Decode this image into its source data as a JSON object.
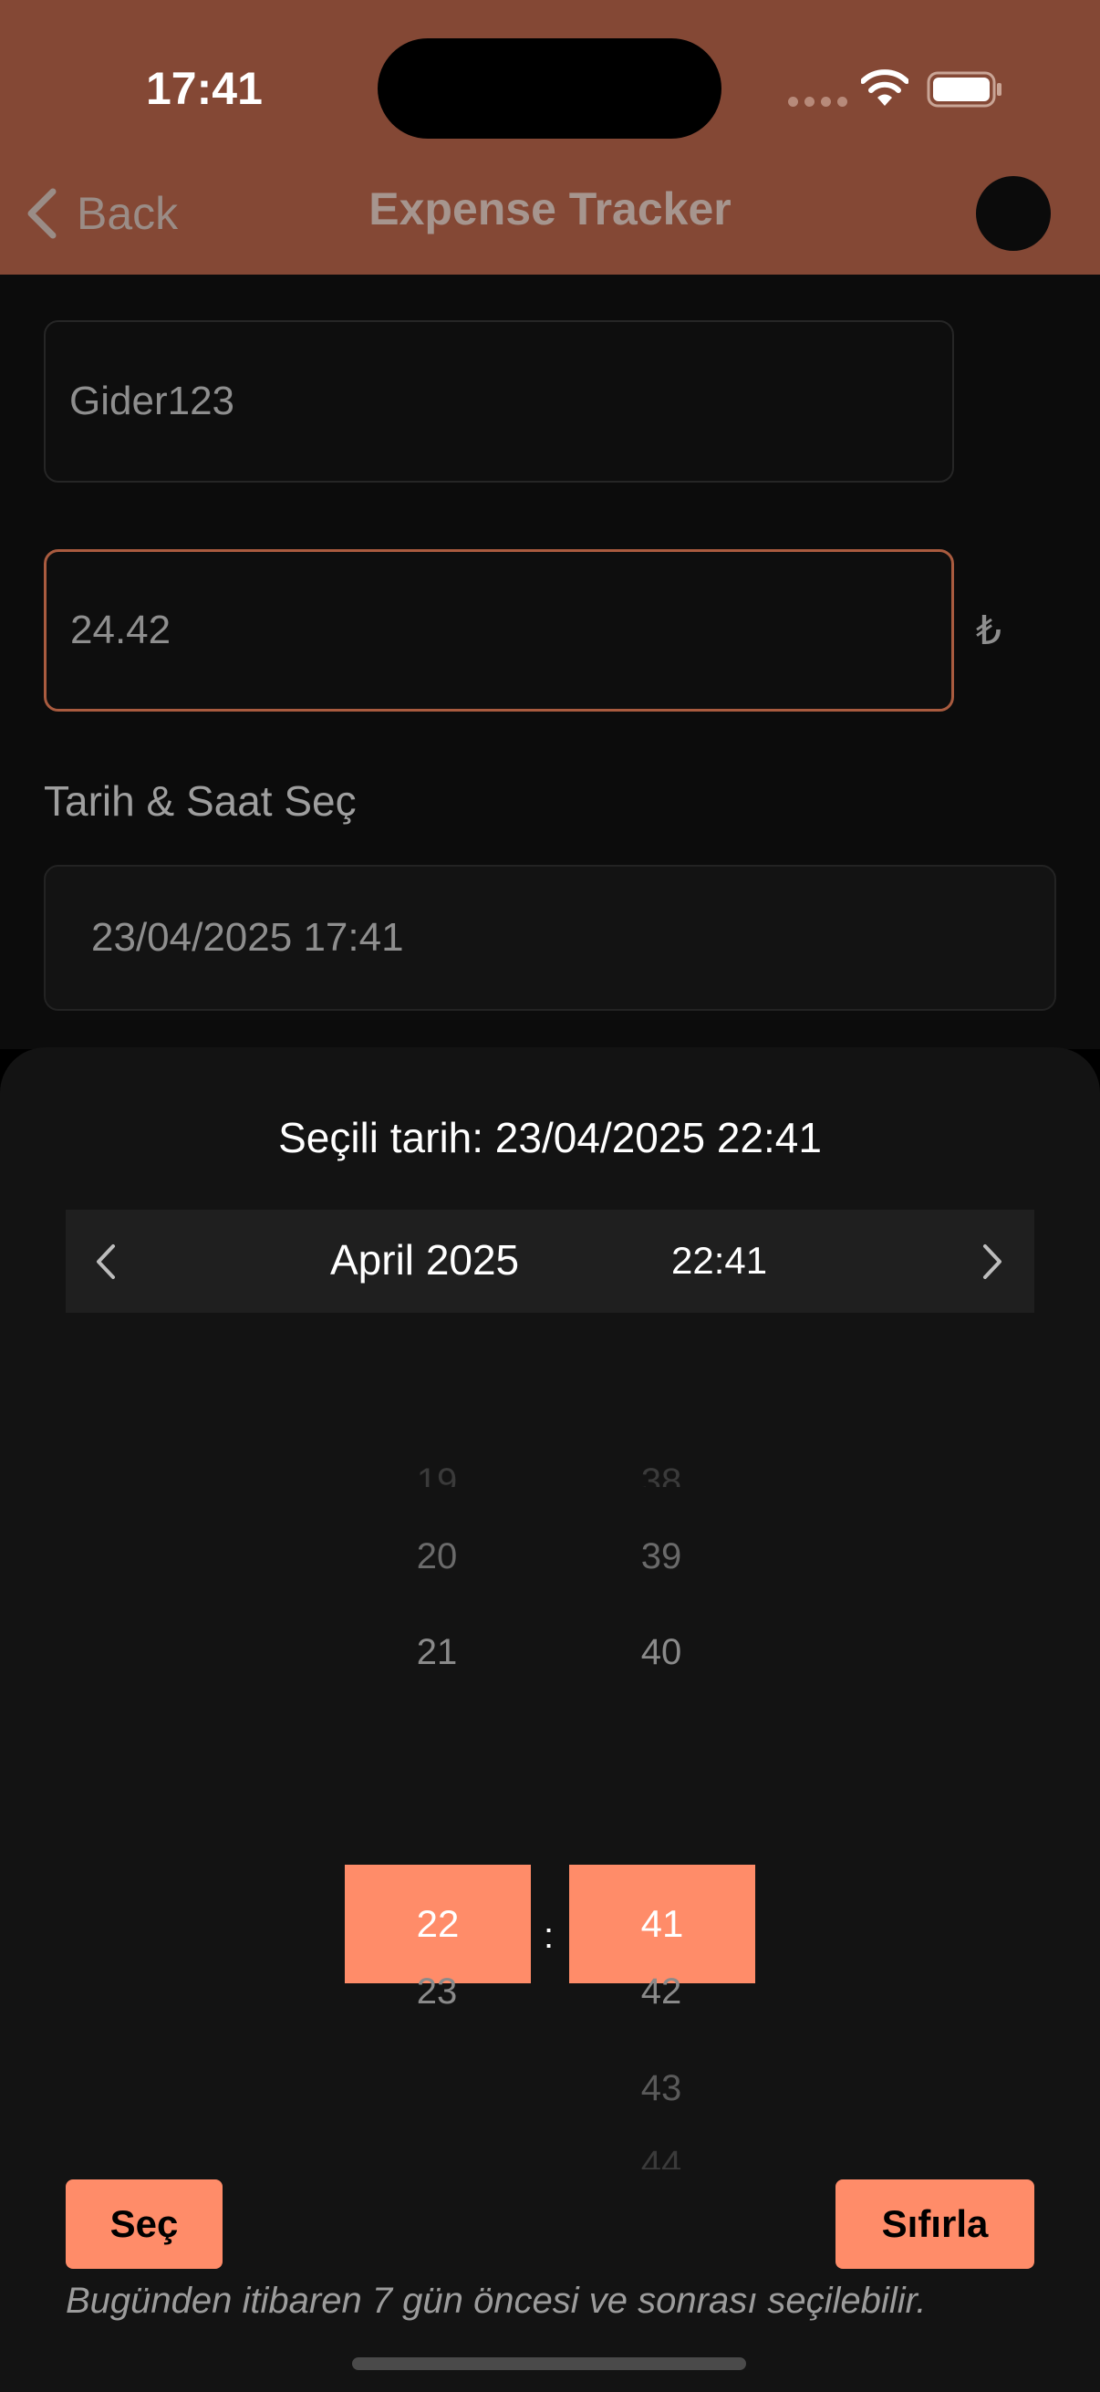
{
  "status_bar": {
    "time": "17:41"
  },
  "nav": {
    "back_label": "Back",
    "title": "Expense Tracker"
  },
  "form": {
    "name_value": "Gider123",
    "amount_value": "24.42",
    "currency_symbol": "₺",
    "date_label": "Tarih & Saat Seç",
    "date_value": "23/04/2025 17:41"
  },
  "picker_sheet": {
    "selected_text": "Seçili tarih: 23/04/2025 22:41",
    "month": "April",
    "year": "2025",
    "time": "22:41",
    "hours": [
      "19",
      "20",
      "21",
      "22",
      "23"
    ],
    "selected_hour": "22",
    "minutes": [
      "38",
      "39",
      "40",
      "41",
      "42",
      "43",
      "44"
    ],
    "selected_minute": "41",
    "separator": ":",
    "select_button": "Seç",
    "reset_button": "Sıfırla",
    "hint": "Bugünden itibaren 7 gün öncesi ve sonrası seçilebilir."
  },
  "colors": {
    "header_bg": "#844835",
    "accent": "#ff8c69",
    "amount_border": "#a95b3f",
    "sheet_bg": "#131313"
  },
  "icons": [
    "wifi-icon",
    "battery-icon",
    "chevron-left-icon",
    "chevron-right-icon",
    "back-chevron-icon"
  ]
}
